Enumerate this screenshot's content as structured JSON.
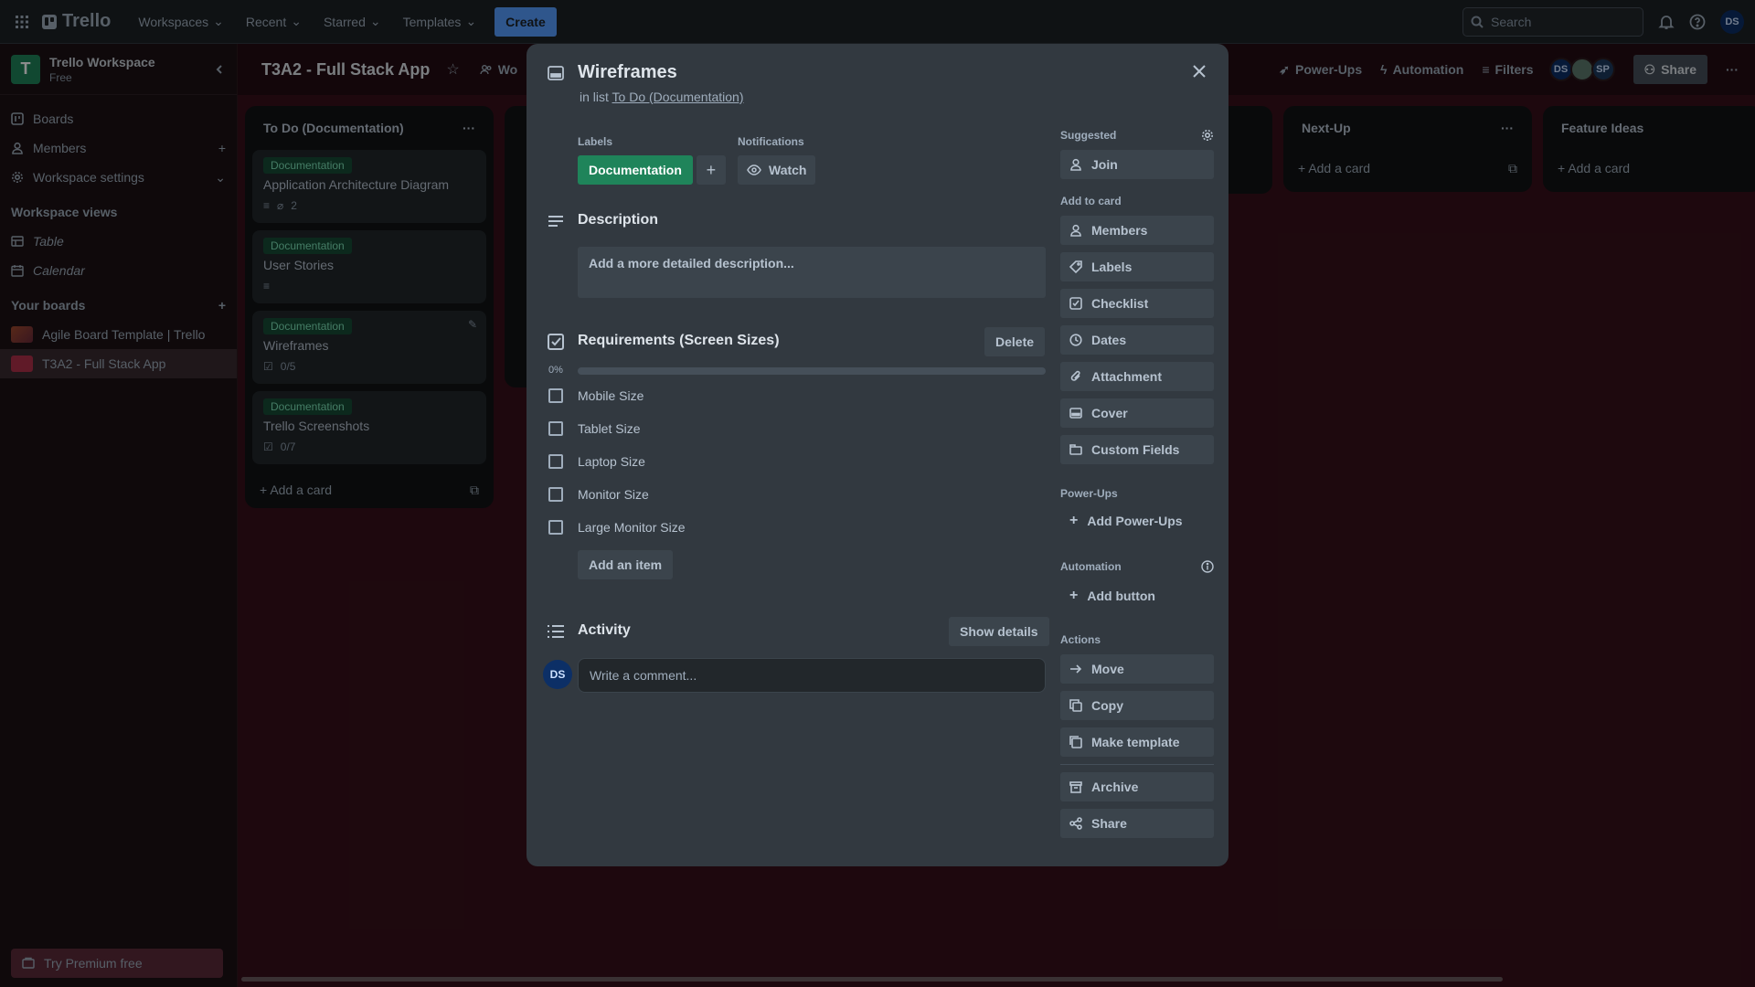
{
  "topbar": {
    "logo": "Trello",
    "menus": [
      "Workspaces",
      "Recent",
      "Starred",
      "Templates"
    ],
    "create_label": "Create",
    "search_placeholder": "Search",
    "avatar": "DS"
  },
  "sidebar": {
    "workspace_initial": "T",
    "workspace_name": "Trello Workspace",
    "workspace_plan": "Free",
    "items": [
      {
        "label": "Boards",
        "icon": "trello-board-icon"
      },
      {
        "label": "Members",
        "icon": "person-icon"
      },
      {
        "label": "Workspace settings",
        "icon": "gear-icon"
      }
    ],
    "views_heading": "Workspace views",
    "views": [
      {
        "label": "Table",
        "icon": "table-icon"
      },
      {
        "label": "Calendar",
        "icon": "calendar-icon"
      }
    ],
    "boards_heading": "Your boards",
    "boards": [
      {
        "label": "Agile Board Template | Trello",
        "color": "#7a3b2e"
      },
      {
        "label": "T3A2 - Full Stack App",
        "color": "#b0304a"
      }
    ],
    "premium_label": "Try Premium free"
  },
  "board": {
    "title": "T3A2 - Full Stack App",
    "workspace_short": "Wo",
    "powerups_label": "Power-Ups",
    "automation_label": "Automation",
    "filters_label": "Filters",
    "members": [
      "DS",
      "",
      "SP"
    ],
    "share_label": "Share",
    "lists": [
      {
        "title": "To Do (Documentation)",
        "cards": [
          {
            "label": "Documentation",
            "title": "Application Architecture Diagram",
            "badge": "2"
          },
          {
            "label": "Documentation",
            "title": "User Stories",
            "badge": ""
          },
          {
            "label": "Documentation",
            "title": "Wireframes",
            "badge": "0/5"
          },
          {
            "label": "Documentation",
            "title": "Trello Screenshots",
            "badge": "0/7"
          }
        ],
        "add_label": "Add a card"
      },
      {
        "title": "Next-Up",
        "add_label": "Add a card"
      },
      {
        "title": "Feature Ideas",
        "add_label": "Add a card"
      }
    ]
  },
  "modal": {
    "title": "Wireframes",
    "in_list_prefix": "in list",
    "in_list_link": "To Do (Documentation)",
    "labels_heading": "Labels",
    "label_chip": "Documentation",
    "notifications_heading": "Notifications",
    "watch_label": "Watch",
    "description_heading": "Description",
    "description_placeholder": "Add a more detailed description...",
    "checklist_title": "Requirements (Screen Sizes)",
    "delete_label": "Delete",
    "progress_text": "0%",
    "progress_fraction": 0,
    "checklist_items": [
      {
        "label": "Mobile Size",
        "checked": false
      },
      {
        "label": "Tablet Size",
        "checked": false
      },
      {
        "label": "Laptop Size",
        "checked": false
      },
      {
        "label": "Monitor Size",
        "checked": false
      },
      {
        "label": "Large Monitor Size",
        "checked": false
      }
    ],
    "add_item_label": "Add an item",
    "activity_heading": "Activity",
    "show_details_label": "Show details",
    "comment_avatar": "DS",
    "comment_placeholder": "Write a comment...",
    "suggested_heading": "Suggested",
    "join_label": "Join",
    "add_to_card_heading": "Add to card",
    "add_to_card": [
      {
        "label": "Members",
        "icon": "person-icon"
      },
      {
        "label": "Labels",
        "icon": "tag-icon"
      },
      {
        "label": "Checklist",
        "icon": "checklist-icon"
      },
      {
        "label": "Dates",
        "icon": "clock-icon"
      },
      {
        "label": "Attachment",
        "icon": "paperclip-icon"
      },
      {
        "label": "Cover",
        "icon": "cover-icon"
      },
      {
        "label": "Custom Fields",
        "icon": "custom-fields-icon"
      }
    ],
    "powerups_heading": "Power-Ups",
    "add_powerups_label": "Add Power-Ups",
    "automation_heading": "Automation",
    "add_button_label": "Add button",
    "actions_heading": "Actions",
    "actions": [
      {
        "label": "Move",
        "icon": "arrow-right-icon"
      },
      {
        "label": "Copy",
        "icon": "copy-icon"
      },
      {
        "label": "Make template",
        "icon": "template-icon"
      },
      {
        "label": "Archive",
        "icon": "archive-icon"
      },
      {
        "label": "Share",
        "icon": "share-icon"
      }
    ]
  }
}
